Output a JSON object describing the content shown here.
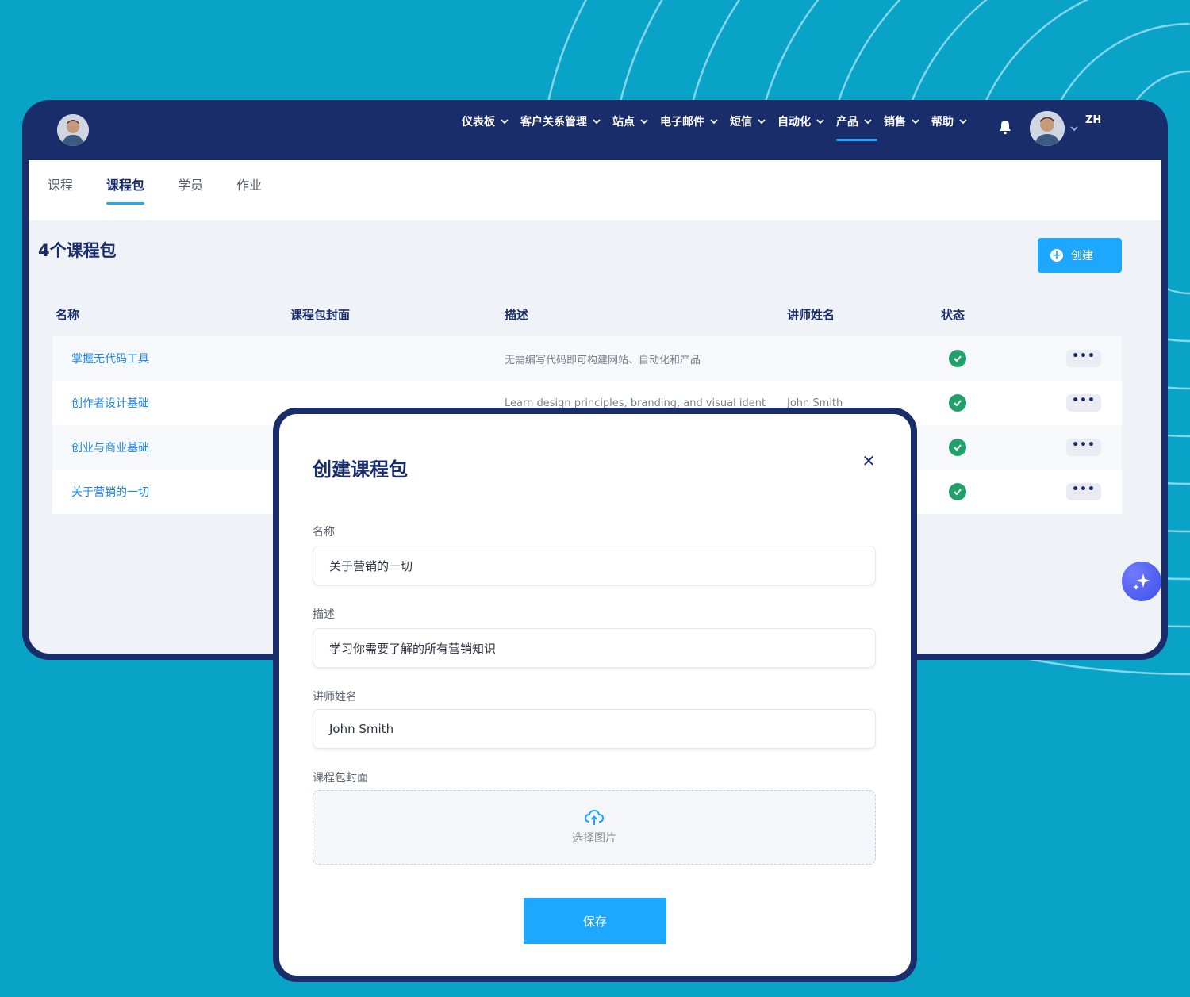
{
  "nav": {
    "items": [
      {
        "label": "仪表板"
      },
      {
        "label": "客户关系管理"
      },
      {
        "label": "站点"
      },
      {
        "label": "电子邮件"
      },
      {
        "label": "短信"
      },
      {
        "label": "自动化"
      },
      {
        "label": "产品",
        "active": true
      },
      {
        "label": "销售"
      },
      {
        "label": "帮助"
      }
    ],
    "language": "ZH"
  },
  "tabs": [
    {
      "label": "课程"
    },
    {
      "label": "课程包",
      "active": true
    },
    {
      "label": "学员"
    },
    {
      "label": "作业"
    }
  ],
  "page": {
    "title": "4个课程包",
    "create_label": "创建"
  },
  "table": {
    "headers": {
      "name": "名称",
      "cover": "课程包封面",
      "description": "描述",
      "instructor": "讲师姓名",
      "status": "状态"
    },
    "rows": [
      {
        "name": "掌握无代码工具",
        "description": "无需编写代码即可构建网站、自动化和产品",
        "instructor": "",
        "status": "active",
        "more": "•••"
      },
      {
        "name": "创作者设计基础",
        "description": "Learn design principles, branding, and visual ident",
        "instructor": "John Smith",
        "status": "active",
        "more": "•••"
      },
      {
        "name": "创业与商业基础",
        "description": "",
        "instructor": "",
        "status": "active",
        "more": "•••"
      },
      {
        "name": "关于营销的一切",
        "description": "",
        "instructor": "",
        "status": "active",
        "more": "•••"
      }
    ]
  },
  "modal": {
    "title": "创建课程包",
    "close_symbol": "✕",
    "fields": {
      "name_label": "名称",
      "name_value": "关于营销的一切",
      "description_label": "描述",
      "description_value": "学习你需要了解的所有营销知识",
      "instructor_label": "讲师姓名",
      "instructor_value": "John Smith",
      "cover_label": "课程包封面",
      "cover_placeholder": "选择图片"
    },
    "save_label": "保存"
  },
  "colors": {
    "background": "#0aa3c8",
    "navy": "#1a2d6b",
    "accent": "#1ea7ff",
    "success": "#22a06b",
    "link": "#1e88e5"
  }
}
